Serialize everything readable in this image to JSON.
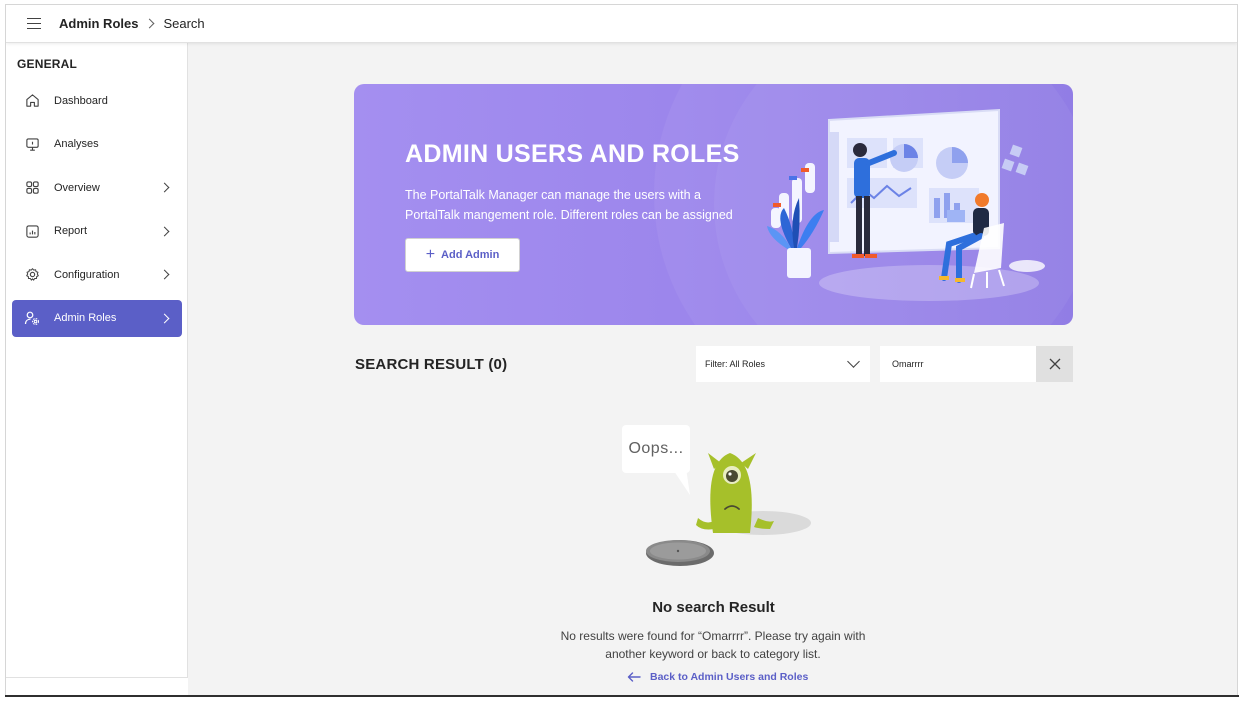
{
  "breadcrumb": {
    "root": "Admin Roles",
    "current": "Search"
  },
  "sidebar": {
    "heading": "GENERAL",
    "items": [
      {
        "label": "Dashboard",
        "icon": "home-icon",
        "has_chevron": false,
        "active": false
      },
      {
        "label": "Analyses",
        "icon": "monitor-icon",
        "has_chevron": false,
        "active": false
      },
      {
        "label": "Overview",
        "icon": "grid-icon",
        "has_chevron": true,
        "active": false
      },
      {
        "label": "Report",
        "icon": "report-icon",
        "has_chevron": true,
        "active": false
      },
      {
        "label": "Configuration",
        "icon": "gear-icon",
        "has_chevron": true,
        "active": false
      },
      {
        "label": "Admin Roles",
        "icon": "person-settings-icon",
        "has_chevron": true,
        "active": true
      }
    ]
  },
  "banner": {
    "title": "ADMIN USERS AND ROLES",
    "description": "The PortalTalk Manager can manage the users with a PortalTalk mangement role. Different roles can be assigned",
    "add_button": "Add Admin"
  },
  "search": {
    "result_title": "SEARCH RESULT (0)",
    "filter_value": "Filter: All Roles",
    "query": "Omarrrr"
  },
  "empty_state": {
    "bubble": "Oops...",
    "title": "No search Result",
    "message": "No results were found for “Omarrrr”. Please try again with another keyword or back to category list.",
    "back_link": "Back to Admin Users and Roles"
  },
  "colors": {
    "brand": "#5b5fc7",
    "banner": "#9c86ec",
    "background": "#f3f3f3"
  }
}
